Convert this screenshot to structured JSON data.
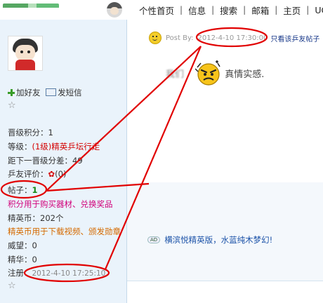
{
  "topnav": {
    "items": [
      "个性首页",
      "信息",
      "搜索",
      "邮箱",
      "主页",
      "UC"
    ]
  },
  "profile": {
    "add_friend": "加好友",
    "send_message": "发短信",
    "level_points": "晋级积分：1",
    "rank_label": "等级：",
    "rank_value": "(1级)精英乒坛行走",
    "next_level": "距下一晋级分差：49",
    "rating_label": "乒友评价：",
    "rating_value": "(0)",
    "posts_label": "帖子：",
    "posts_value": "1",
    "posts_note": "积分用于购买器材、兑换奖品",
    "coins": "精英币：202个",
    "coins_note": "精英币用于下载视频、颁发勋章",
    "prestige": "威望：0",
    "digest": "精华：0",
    "register_label": "注册：",
    "register_value": "2012-4-10 17:25:10"
  },
  "post": {
    "meta_label": "Post By:",
    "meta_time": "2012-4-10 17:30:00",
    "only_view": "只看该乒友帖子",
    "text_left": "我们",
    "text_right": "真情实感."
  },
  "signature": {
    "ad_tag": "AD",
    "ad_link": "横滨悦精英版，水蓝纯木梦幻!"
  },
  "colors": {
    "sidebar_bg": "#eaf3fb",
    "annotation": "#e10000",
    "link": "#1b52a8"
  }
}
